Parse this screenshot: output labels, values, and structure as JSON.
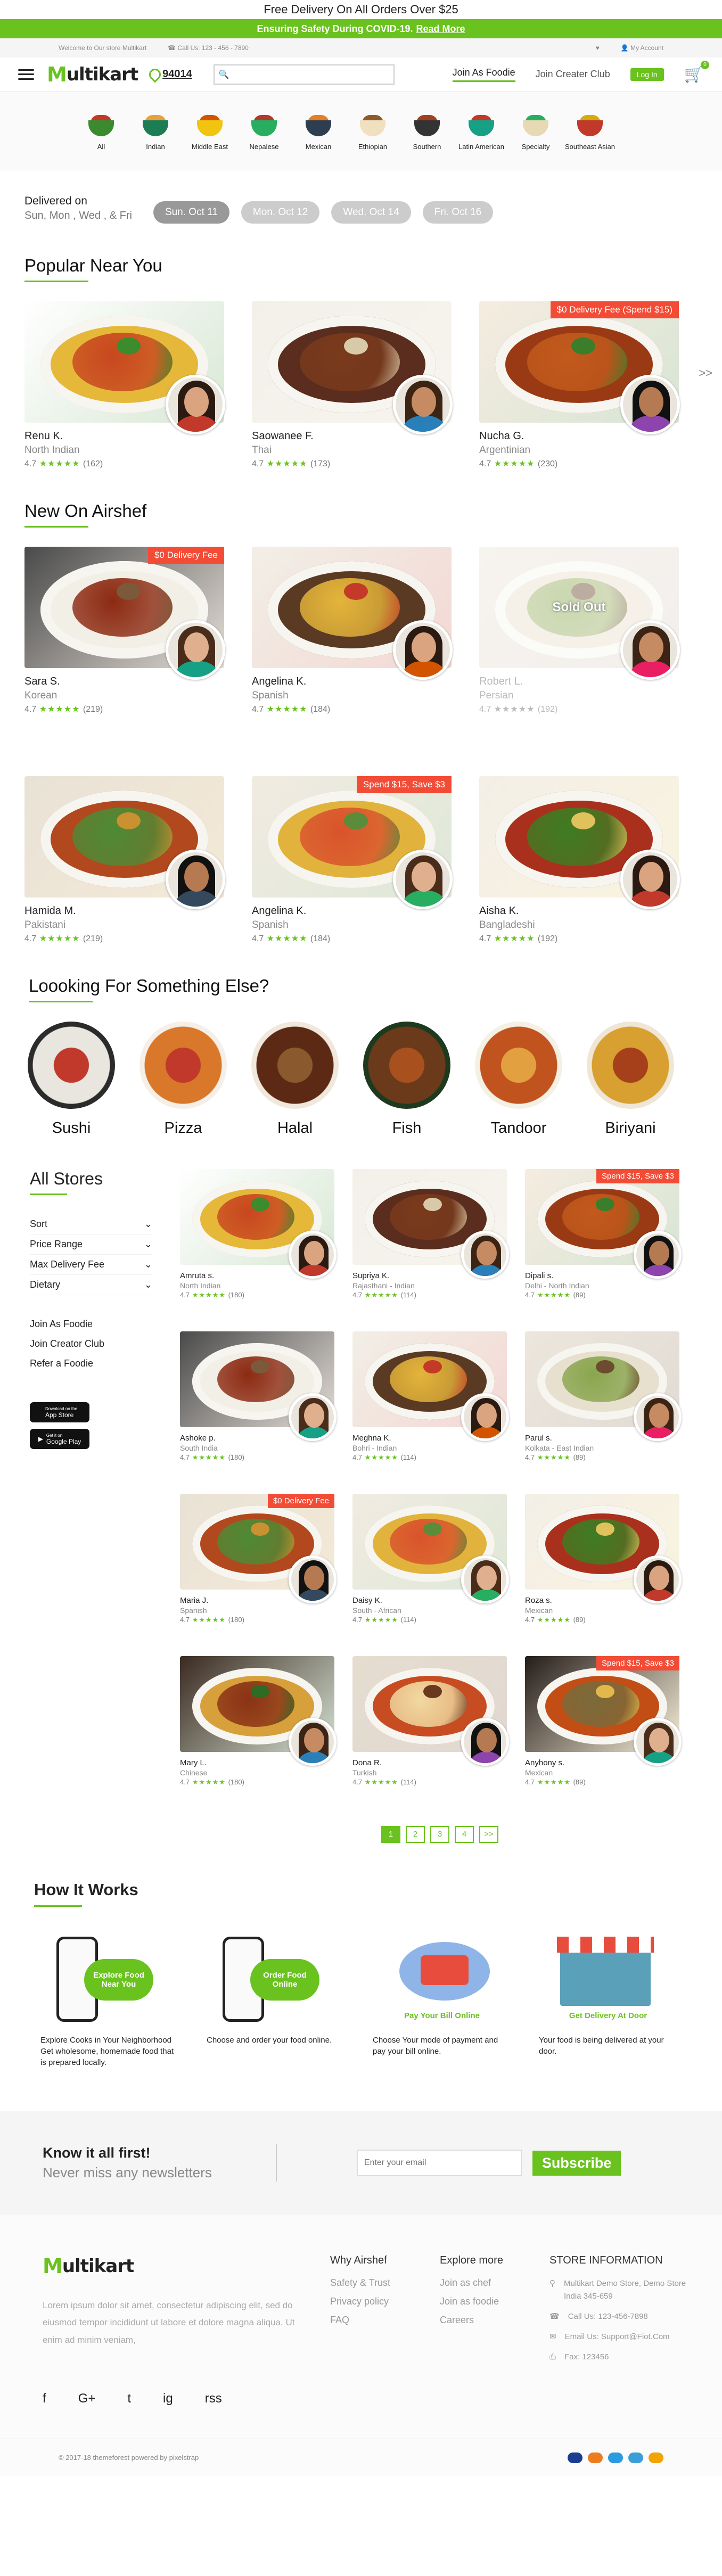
{
  "promo": {
    "text": "Free Delivery On All Orders Over $25"
  },
  "covid": {
    "text": "Ensuring Safety During COVID-19.",
    "link": "Read More"
  },
  "topstrip": {
    "welcome": "Welcome to Our store Multikart",
    "call": "Call Us: 123 - 456 - 7890",
    "account": "My Account"
  },
  "header": {
    "logo_m": "M",
    "logo_rest": "ultikart",
    "zip": "94014",
    "nav": [
      "Join As Foodie",
      "Join Creater Club"
    ],
    "login": "Log In",
    "cart_count": "0"
  },
  "categories": [
    "All",
    "Indian",
    "Middle East",
    "Nepalese",
    "Mexican",
    "Ethiopian",
    "Southern",
    "Latin American",
    "Specialty",
    "Southeast Asian"
  ],
  "delivered": {
    "label": "Delivered on",
    "days": "Sun, Mon , Wed , & Fri",
    "dates": [
      "Sun. Oct 11",
      "Mon. Oct 12",
      "Wed. Oct 14",
      "Fri. Oct 16"
    ]
  },
  "popular": {
    "title": "Popular Near You",
    "arrow": ">>",
    "items": [
      {
        "name": "Renu K.",
        "cuisine": "North Indian",
        "rating": "4.7",
        "count": "(162)"
      },
      {
        "name": "Saowanee F.",
        "cuisine": "Thai",
        "rating": "4.7",
        "count": "(173)"
      },
      {
        "name": "Nucha G.",
        "cuisine": "Argentinian",
        "rating": "4.7",
        "count": "(230)",
        "tag": "$0 Delivery Fee (Spend $15)"
      }
    ]
  },
  "new_on": {
    "title": "New On Airshef",
    "items": [
      {
        "name": "Sara S.",
        "cuisine": "Korean",
        "rating": "4.7",
        "count": "(219)",
        "tag": "$0 Delivery Fee"
      },
      {
        "name": "Angelina K.",
        "cuisine": "Spanish",
        "rating": "4.7",
        "count": "(184)"
      },
      {
        "name": "Robert L.",
        "cuisine": "Persian",
        "rating": "4.7",
        "count": "(192)",
        "overlay": "Sold Out"
      },
      {
        "name": "Hamida M.",
        "cuisine": "Pakistani",
        "rating": "4.7",
        "count": "(219)"
      },
      {
        "name": "Angelina K.",
        "cuisine": "Spanish",
        "rating": "4.7",
        "count": "(184)",
        "tag": "Spend $15, Save $3"
      },
      {
        "name": "Aisha K.",
        "cuisine": "Bangladeshi",
        "rating": "4.7",
        "count": "(192)"
      }
    ]
  },
  "looking": {
    "title": "Loooking For Something Else?",
    "items": [
      "Sushi",
      "Pizza",
      "Halal",
      "Fish",
      "Tandoor",
      "Biriyani"
    ]
  },
  "stores": {
    "title": "All Stores",
    "filters": [
      "Sort",
      "Price Range",
      "Max Delivery Fee",
      "Dietary"
    ],
    "links": [
      "Join As Foodie",
      "Join Creator Club",
      "Refer a Foodie"
    ],
    "appstore": "App Store",
    "googleplay": "Google Play",
    "appstore_small": "Download on the",
    "googleplay_small": "Get it on",
    "items": [
      {
        "name": "Amruta s.",
        "cuisine": "North Indian",
        "rating": "4.7",
        "count": "(180)"
      },
      {
        "name": "Supriya K.",
        "cuisine": "Rajasthani - Indian",
        "rating": "4.7",
        "count": "(114)"
      },
      {
        "name": "Dipali s.",
        "cuisine": "Delhi - North Indian",
        "rating": "4.7",
        "count": "(89)",
        "tag": "Spend $15, Save $3"
      },
      {
        "name": "Ashoke p.",
        "cuisine": "South India",
        "rating": "4.7",
        "count": "(180)"
      },
      {
        "name": "Meghna K.",
        "cuisine": "Bohri - Indian",
        "rating": "4.7",
        "count": "(114)"
      },
      {
        "name": "Parul s.",
        "cuisine": "Kolkata - East Indian",
        "rating": "4.7",
        "count": "(89)"
      },
      {
        "name": "Maria J.",
        "cuisine": "Spanish",
        "rating": "4.7",
        "count": "(180)",
        "tag": "$0 Delivery Fee"
      },
      {
        "name": "Daisy K.",
        "cuisine": "South - African",
        "rating": "4.7",
        "count": "(114)"
      },
      {
        "name": "Roza s.",
        "cuisine": "Mexican",
        "rating": "4.7",
        "count": "(89)"
      },
      {
        "name": "Mary L.",
        "cuisine": "Chinese",
        "rating": "4.7",
        "count": "(180)"
      },
      {
        "name": "Dona R.",
        "cuisine": "Turkish",
        "rating": "4.7",
        "count": "(114)"
      },
      {
        "name": "Anyhony s.",
        "cuisine": "Mexican",
        "rating": "4.7",
        "count": "(89)",
        "tag": "Spend $15, Save $3"
      }
    ],
    "pages": [
      "1",
      "2",
      "3",
      "4",
      ">>"
    ]
  },
  "how": {
    "title": "How It Works",
    "steps": [
      {
        "badge": "Explore Food Near You",
        "cap": "Explore Cooks in Your Neighborhood Get wholesome, homemade food that is prepared locally."
      },
      {
        "badge": "Order Food Online",
        "cap": "Choose and order your food online."
      },
      {
        "badge": "Pay Your Bill Online",
        "cap": "Choose Your mode of payment and pay your bill online."
      },
      {
        "badge": "Get Delivery At Door",
        "cap": "Your food is being delivered at your door."
      }
    ]
  },
  "newsletter": {
    "title": "Know it all first!",
    "sub": "Never miss any newsletters",
    "placeholder": "Enter your email",
    "button": "Subscribe"
  },
  "footer": {
    "about": "Lorem ipsum dolor sit amet, consectetur adipiscing elit, sed do eiusmod tempor incididunt ut labore et dolore magna aliqua. Ut enim ad minim veniam,",
    "col1_title": "Why Airshef",
    "col1": [
      "Safety & Trust",
      "Privacy policy",
      "FAQ"
    ],
    "col2_title": "Explore more",
    "col2": [
      "Join as chef",
      "Join as foodie",
      "Careers"
    ],
    "col3_title": "STORE INFORMATION",
    "address": "Multikart Demo Store, Demo Store India 345-659",
    "phone": "Call Us: 123-456-7898",
    "email": "Email Us: Support@Fiot.Com",
    "fax": "Fax: 123456",
    "social": [
      "f",
      "G+",
      "t",
      "ig",
      "rss"
    ]
  },
  "copyright": "© 2017-18 themeforest powered by pixelstrap"
}
